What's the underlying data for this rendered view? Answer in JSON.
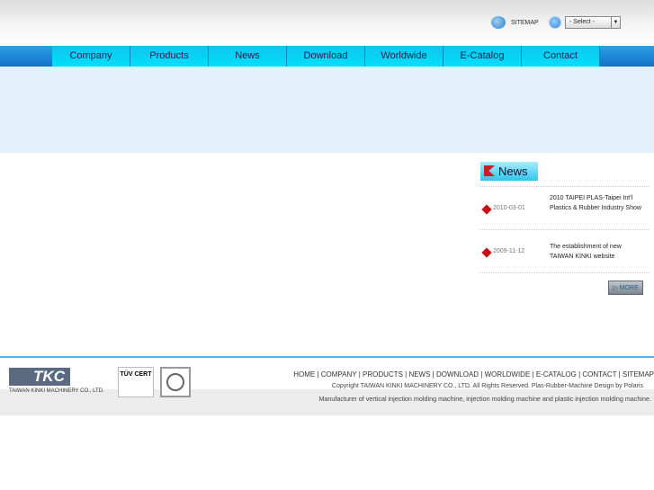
{
  "header": {
    "sitemap_label": "SITEMAP",
    "language_select": "- Select -"
  },
  "nav": [
    "Company",
    "Products",
    "News",
    "Download",
    "Worldwide",
    "E-Catalog",
    "Contact"
  ],
  "news": {
    "heading": "News",
    "items": [
      {
        "date": "2010-03-01",
        "title": "2010 TAIPEI PLAS-Taipei Int'l Plastics & Rubber Industry Show"
      },
      {
        "date": "2009-11-12",
        "title": "The establishment of new TAIWAN KINKI website"
      }
    ],
    "more_label": "MORE"
  },
  "footer": {
    "logo_text": "TKC",
    "company": "TAIWAN KINKI MACHINERY CO., LTD.",
    "cert": "TÜV CERT",
    "links": [
      "HOME",
      "COMPANY",
      "PRODUCTS",
      "NEWS",
      "DOWNLOAD",
      "WORLDWIDE",
      "E-CATALOG",
      "CONTACT",
      "SITEMAP"
    ],
    "copyright": "Copyright TAIWAN KINKI MACHINERY CO., LTD. All Rights Reserved. Plas-Rubber-Machine Design by Polaris",
    "tagline": "Manufacturer of vertical injection molding machine, injection molding machine and plastic injection molding machine."
  }
}
